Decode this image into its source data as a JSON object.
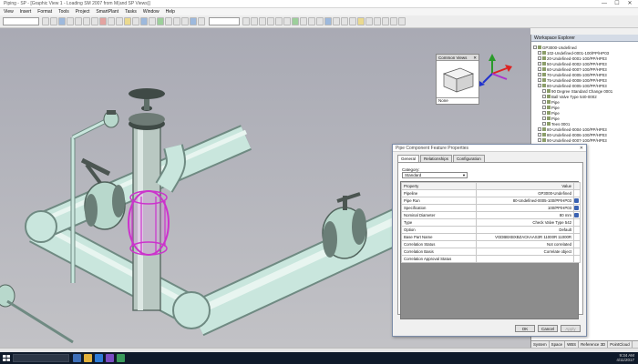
{
  "window": {
    "title": "Piping - SP - [Graphic View 1 - Loading SM 2007 from M(and SP Views)]",
    "controls": [
      "—",
      "☐",
      "✕"
    ]
  },
  "menu": [
    "View",
    "Insert",
    "Format",
    "Tools",
    "Project",
    "SmartPlant",
    "Tasks",
    "Window",
    "Help"
  ],
  "common_views": {
    "title": "Common Views",
    "footer": "None"
  },
  "workspace_explorer": {
    "title": "Workspace Explorer",
    "items": [
      {
        "label": "GP3000-Undefined",
        "level": 0
      },
      {
        "label": "102-Undefined-0001-100/PP/HP03",
        "level": 1
      },
      {
        "label": "20-Undefined-0001-100/PP/HP03",
        "level": 1
      },
      {
        "label": "50-Undefined-0002-100/PP/HP03",
        "level": 1
      },
      {
        "label": "60-Undefined-0007-100/PP/HP03",
        "level": 1
      },
      {
        "label": "70-Undefined-0005-100/PP/HP03",
        "level": 1
      },
      {
        "label": "75-Undefined-0008-100/PP/HP03",
        "level": 1
      },
      {
        "label": "80-Undefined-0005-100/PP/HP03",
        "level": 1
      },
      {
        "label": "90 Degree Standard Change 0001",
        "level": 2
      },
      {
        "label": "Ball Valve Type 540-0002",
        "level": 2
      },
      {
        "label": "Pipe",
        "level": 2
      },
      {
        "label": "Pipe",
        "level": 2
      },
      {
        "label": "Pipe",
        "level": 2
      },
      {
        "label": "Pipe",
        "level": 2
      },
      {
        "label": "Tees 0001",
        "level": 2
      },
      {
        "label": "80-Undefined-0004-100/PP/HP03",
        "level": 1
      },
      {
        "label": "80-Undefined-0006-100/PP/HP03",
        "level": 1
      },
      {
        "label": "90-Undefined-0007-100/PP/HP03",
        "level": 1
      }
    ],
    "tabs": [
      "System",
      "Space",
      "WBS",
      "Reference 3D",
      "PointCloud"
    ]
  },
  "dialog": {
    "title": "Pipe Component Feature Properties",
    "tabs": [
      "General",
      "Relationships",
      "Configuration"
    ],
    "category_label": "Category:",
    "category_value": "Standard",
    "header": {
      "property": "Property",
      "value": "Value"
    },
    "rows": [
      {
        "property": "Pipeline",
        "value": "GP3000-Undefined",
        "locked": false
      },
      {
        "property": "Pipe Run",
        "value": "80-Undefined-0005-100/PP/HP03",
        "locked": true
      },
      {
        "property": "Specification",
        "value": "100/PP/HP03",
        "locked": true
      },
      {
        "property": "Nominal Diameter",
        "value": "80 mm",
        "locked": true
      },
      {
        "property": "Type",
        "value": "Check Valve Type 542",
        "locked": false
      },
      {
        "property": "Option",
        "value": "Default",
        "locked": false
      },
      {
        "property": "Base Part Name",
        "value": "VGDBBXBXBZACKAAS3R 11000R 11000R",
        "locked": false
      },
      {
        "property": "Correlation Status",
        "value": "Not correlated",
        "locked": false
      },
      {
        "property": "Correlation Basis",
        "value": "Correlate object",
        "locked": false
      },
      {
        "property": "Correlation Approval Status",
        "value": "",
        "locked": false
      }
    ],
    "buttons": {
      "ok": "OK",
      "cancel": "Cancel",
      "apply": "Apply"
    }
  },
  "taskbar": {
    "time": "9:34 AM",
    "date": "4/11/2017"
  },
  "colors": {
    "pipe": "#c9e6dd",
    "selection": "#cc33cc",
    "viewport": "#b6b6bd"
  }
}
